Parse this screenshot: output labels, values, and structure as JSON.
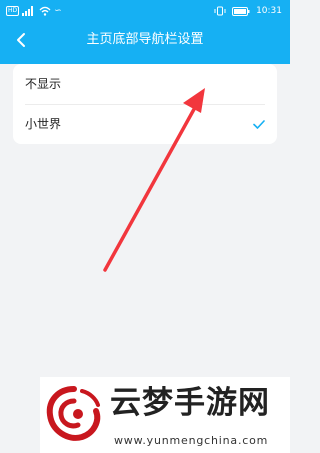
{
  "status_bar": {
    "network_badge": "HD",
    "time": "10:31"
  },
  "header": {
    "title": "主页底部导航栏设置",
    "background_color": "#16b0f3"
  },
  "options": [
    {
      "label": "不显示",
      "selected": false
    },
    {
      "label": "小世界",
      "selected": true
    }
  ],
  "accent_color": "#16b0f3",
  "annotation_color": "#f2363d",
  "watermark": {
    "brand": "云梦手游网",
    "url": "www.yunmengchina.com"
  }
}
